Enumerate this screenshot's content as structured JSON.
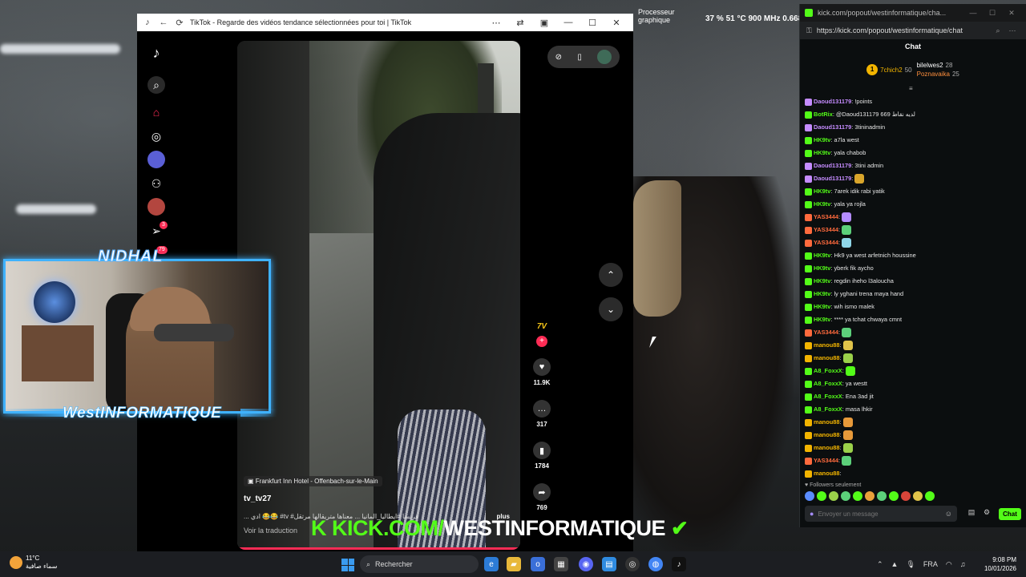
{
  "desktop": {
    "sysmon_label_1": "Processeur",
    "sysmon_label_2": "graphique",
    "sysmon_stats": "37 %  51 °C  900 MHz  0.668"
  },
  "tiktok_window": {
    "title": "TikTok - Regarde des vidéos tendance sélectionnées pour toi | TikTok",
    "sidebar": {
      "notifications_badge": "3",
      "profile_badge": "79"
    },
    "video": {
      "location": "Frankfurt Inn Hotel - Offenbach-sur-le-Main",
      "username": "tv_tv27",
      "caption": "... ادي 😂😂 #tv #فرنسا #ايطاليا_المانيا ... معناها متريقالها مرتقل",
      "more_label": "plus",
      "translate_label": "Voir la traduction",
      "creator_logo": "7V",
      "likes": "11.9K",
      "comments": "317",
      "saves": "1784",
      "shares": "769"
    }
  },
  "stream_overlay": {
    "cam_name": "NIDHAL",
    "brand": "WestINFORMATIQUE",
    "kick_banner_prefix": "KICK.COM/",
    "kick_banner_suffix": "WESTINFORMATIQUE"
  },
  "kick_chat": {
    "window_title": "kick.com/popout/westinformatique/cha...",
    "url": "https://kick.com/popout/westinformatique/chat",
    "heading": "Chat",
    "leaders": [
      {
        "name": "7chich2",
        "points": "50"
      },
      {
        "name": "bilelwes2",
        "points": "28"
      },
      {
        "name": "Poznavaika",
        "points": "25"
      }
    ],
    "messages": [
      {
        "user": "Daoud131179",
        "text": ": !points",
        "color": "#c58cff"
      },
      {
        "user": "BotRix",
        "text": ": @Daoud131179 669 لديه نقاط",
        "color": "#53fc18"
      },
      {
        "user": "Daoud131179",
        "text": ": 3tininadmin",
        "color": "#c58cff"
      },
      {
        "user": "HK9tv",
        "text": ": a7la west",
        "color": "#53fc18"
      },
      {
        "user": "HK9tv",
        "text": ": yala chabob",
        "color": "#53fc18"
      },
      {
        "user": "Daoud131179",
        "text": ": 3tini admin",
        "color": "#c58cff"
      },
      {
        "user": "Daoud131179",
        "text": ":",
        "color": "#c58cff",
        "emote": "#d9a52b"
      },
      {
        "user": "HK9tv",
        "text": ": 7arek idik rabi yatik",
        "color": "#53fc18"
      },
      {
        "user": "HK9tv",
        "text": ": yala ya rojla",
        "color": "#53fc18"
      },
      {
        "user": "YAS3444",
        "text": ":",
        "color": "#ff6a3d",
        "emote": "#b48cff"
      },
      {
        "user": "YAS3444",
        "text": ":",
        "color": "#ff6a3d",
        "emote": "#5cd07a"
      },
      {
        "user": "YAS3444",
        "text": ":",
        "color": "#ff6a3d",
        "emote": "#8fd6e8"
      },
      {
        "user": "HK9tv",
        "text": ": Hk9 ya west arfetnich houssine",
        "color": "#53fc18"
      },
      {
        "user": "HK9tv",
        "text": ": yberk fik aycho",
        "color": "#53fc18"
      },
      {
        "user": "HK9tv",
        "text": ": regdin iheho l3aloucha",
        "color": "#53fc18"
      },
      {
        "user": "HK9tv",
        "text": ": ly yghani trena maya hand",
        "color": "#53fc18"
      },
      {
        "user": "HK9tv",
        "text": ": wih ismo malek",
        "color": "#53fc18"
      },
      {
        "user": "HK9tv",
        "text": ": **** ya tchat chwaya cmnt",
        "color": "#53fc18"
      },
      {
        "user": "YAS3444",
        "text": ":",
        "color": "#ff6a3d",
        "emote": "#5cd07a"
      },
      {
        "user": "manou88",
        "text": ":",
        "color": "#f2b400",
        "emote": "#e0c34a"
      },
      {
        "user": "manou88",
        "text": ":",
        "color": "#f2b400",
        "emote": "#9bd14a"
      },
      {
        "user": "A8_FoxxX",
        "text": ":",
        "color": "#53fc18",
        "emote": "#53fc18"
      },
      {
        "user": "A8_FoxxX",
        "text": ": ya westt",
        "color": "#53fc18"
      },
      {
        "user": "A8_FoxxX",
        "text": ": Ena 3ad jit",
        "color": "#53fc18"
      },
      {
        "user": "A8_FoxxX",
        "text": ": masa lhkir",
        "color": "#53fc18"
      },
      {
        "user": "manou88",
        "text": ":",
        "color": "#f2b400",
        "emote": "#e89a3a"
      },
      {
        "user": "manou88",
        "text": ":",
        "color": "#f2b400",
        "emote": "#e89a3a"
      },
      {
        "user": "manou88",
        "text": ":",
        "color": "#f2b400",
        "emote": "#9bd14a"
      },
      {
        "user": "YAS3444",
        "text": ":",
        "color": "#ff6a3d",
        "emote": "#5cd07a"
      },
      {
        "user": "manou88",
        "text": ":",
        "color": "#f2b400"
      }
    ],
    "followers_only": "Followers seulement",
    "input_placeholder": "Envoyer un message",
    "send_label": "Chat"
  },
  "taskbar": {
    "weather_temp": "11°C",
    "weather_desc": "سماء صافية",
    "search_label": "Rechercher",
    "language": "FRA",
    "time": "9:08 PM",
    "date": "10/01/2026"
  },
  "colors": {
    "kick_green": "#53fc18",
    "tiktok_red": "#fe2c55",
    "overlay_blue": "#3fb2ff"
  }
}
